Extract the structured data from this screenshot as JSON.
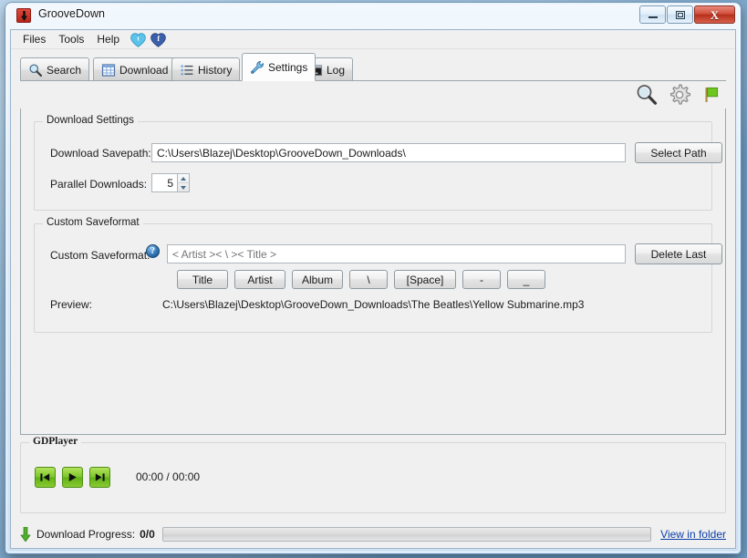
{
  "window": {
    "title": "GrooveDown",
    "app_icon": "download-arrow-icon",
    "buttons": {
      "minimize": "minimize-icon",
      "maximize": "maximize-icon",
      "close": "X"
    }
  },
  "menubar": {
    "items": [
      {
        "label": "Files",
        "name": "menu-files"
      },
      {
        "label": "Tools",
        "name": "menu-tools"
      },
      {
        "label": "Help",
        "name": "menu-help"
      }
    ],
    "social": [
      {
        "name": "twitter-icon",
        "color": "#5cc2e8"
      },
      {
        "name": "facebook-icon",
        "color": "#3b5998"
      }
    ]
  },
  "tabs": [
    {
      "label": "Search",
      "icon": "magnifier-icon",
      "active": false
    },
    {
      "label": "Download",
      "icon": "grid-icon",
      "active": false
    },
    {
      "label": "History",
      "icon": "list-icon",
      "active": false
    },
    {
      "label": "Settings",
      "icon": "wrench-icon",
      "active": true
    },
    {
      "label": "Log",
      "icon": "console-icon",
      "active": false
    }
  ],
  "toolbar_right": [
    {
      "name": "search-icon",
      "label": "search"
    },
    {
      "name": "gear-icon",
      "label": "settings"
    },
    {
      "name": "flag-icon",
      "label": "flag",
      "color": "#6ec61e"
    }
  ],
  "download_settings": {
    "group_title": "Download Settings",
    "savepath_label": "Download Savepath:",
    "savepath_value": "C:\\Users\\Blazej\\Desktop\\GrooveDown_Downloads\\",
    "select_path_button": "Select Path",
    "parallel_label": "Parallel Downloads:",
    "parallel_value": "5"
  },
  "custom_saveformat": {
    "group_title": "Custom Saveformat",
    "field_label": "Custom Saveformat:",
    "help_icon": "?",
    "field_value": "",
    "field_placeholder": "< Artist >< \\ >< Title >",
    "delete_last_button": "Delete Last",
    "token_buttons": [
      "Title",
      "Artist",
      "Album",
      "\\",
      "[Space]",
      "-",
      "_"
    ],
    "preview_label": "Preview:",
    "preview_value": "C:\\Users\\Blazej\\Desktop\\GrooveDown_Downloads\\The Beatles\\Yellow Submarine.mp3"
  },
  "player": {
    "group_title": "GDPlayer",
    "buttons": [
      {
        "name": "previous-track-button",
        "icon": "skip-back-icon"
      },
      {
        "name": "play-button",
        "icon": "play-icon"
      },
      {
        "name": "next-track-button",
        "icon": "skip-forward-icon"
      }
    ],
    "time": "00:00 / 00:00"
  },
  "statusbar": {
    "download_icon": "download-arrow-icon",
    "label": "Download Progress:",
    "count": "0/0",
    "progress_percent": 0,
    "view_in_folder": "View in folder"
  }
}
